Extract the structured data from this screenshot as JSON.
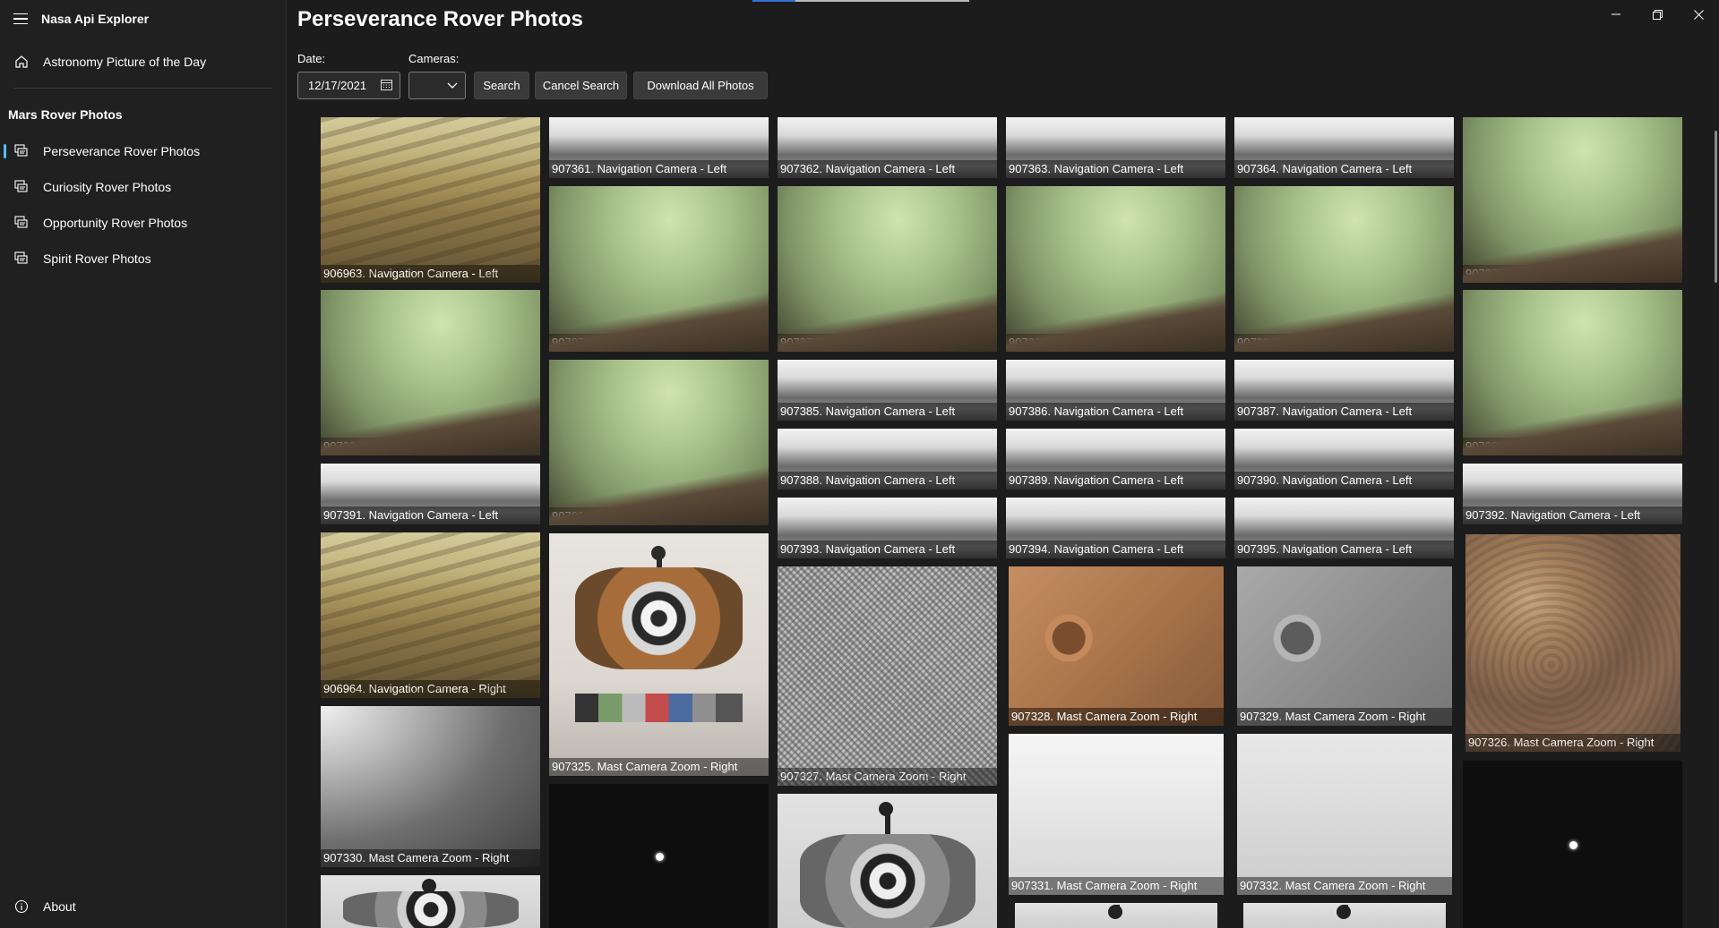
{
  "app": {
    "title": "Nasa Api Explorer"
  },
  "sidebar": {
    "top_item": "Astronomy Picture of the Day",
    "group_title": "Mars Rover Photos",
    "items": [
      {
        "label": "Perseverance Rover Photos",
        "selected": true
      },
      {
        "label": "Curiosity Rover Photos",
        "selected": false
      },
      {
        "label": "Opportunity Rover Photos",
        "selected": false
      },
      {
        "label": "Spirit Rover Photos",
        "selected": false
      }
    ],
    "footer_item": "About"
  },
  "main": {
    "title": "Perseverance Rover Photos",
    "date_label": "Date:",
    "date_value": "12/17/2021",
    "cameras_label": "Cameras:",
    "cameras_value": "",
    "search_button": "Search",
    "cancel_button": "Cancel Search",
    "download_button": "Download All Photos"
  },
  "window_controls": [
    "minimize",
    "maximize",
    "close"
  ],
  "photos": {
    "p906963": "906963. Navigation Camera - Left",
    "p907361": "907361. Navigation Camera - Left",
    "p907362": "907362. Navigation Camera - Left",
    "p907363": "907363. Navigation Camera - Left",
    "p907364": "907364. Navigation Camera - Left",
    "p907377": "907377. Navigation Camera - Left",
    "p907378": "907378. Navigation Camera - Left",
    "p907379": "907379. Navigation Camera - Left",
    "p907380": "907380. Navigation Camera - Left",
    "p907381": "907381. Navigation Camera - Left",
    "p907382": "907382. Navigation Camera - Left",
    "p907384": "907384. Navigation Camera - Left",
    "p907385": "907385. Navigation Camera - Left",
    "p907386": "907386. Navigation Camera - Left",
    "p907387": "907387. Navigation Camera - Left",
    "p907383": "907383. Navigation Camera - Left",
    "p907388": "907388. Navigation Camera - Left",
    "p907389": "907389. Navigation Camera - Left",
    "p907390": "907390. Navigation Camera - Left",
    "p907391": "907391. Navigation Camera - Left",
    "p907392": "907392. Navigation Camera - Left",
    "p907393": "907393. Navigation Camera - Left",
    "p907394": "907394. Navigation Camera - Left",
    "p907395": "907395. Navigation Camera - Left",
    "p906964": "906964. Navigation Camera - Right",
    "p907325": "907325. Mast Camera Zoom - Right",
    "p907327": "907327. Mast Camera Zoom - Right",
    "p907328": "907328. Mast Camera Zoom - Right",
    "p907329": "907329. Mast Camera Zoom - Right",
    "p907326": "907326. Mast Camera Zoom - Right",
    "p907330": "907330. Mast Camera Zoom - Right",
    "p907331": "907331. Mast Camera Zoom - Right",
    "p907332": "907332. Mast Camera Zoom - Right"
  }
}
